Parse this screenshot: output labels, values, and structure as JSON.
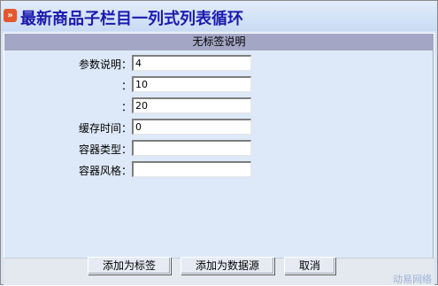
{
  "dialog": {
    "title": "最新商品子栏目一列式列表循环",
    "title_icon_glyph": "»",
    "section_header": "无标签说明"
  },
  "form": {
    "rows": [
      {
        "label": "参数说明：",
        "value": "4"
      },
      {
        "label": "：",
        "value": "10"
      },
      {
        "label": "：",
        "value": "20"
      },
      {
        "label": "缓存时间：",
        "value": "0"
      },
      {
        "label": "容器类型：",
        "value": ""
      },
      {
        "label": "容器风格：",
        "value": ""
      }
    ]
  },
  "buttons": {
    "add_as_tag": "添加为标签",
    "add_as_datasource": "添加为数据源",
    "cancel": "取消"
  },
  "watermark": "动易网络",
  "colors": {
    "title_text": "#1A1AB0",
    "panel_background": "#D6E4F6",
    "section_header_bg": "#A3A6C4",
    "icon_accent": "#E4572E"
  }
}
